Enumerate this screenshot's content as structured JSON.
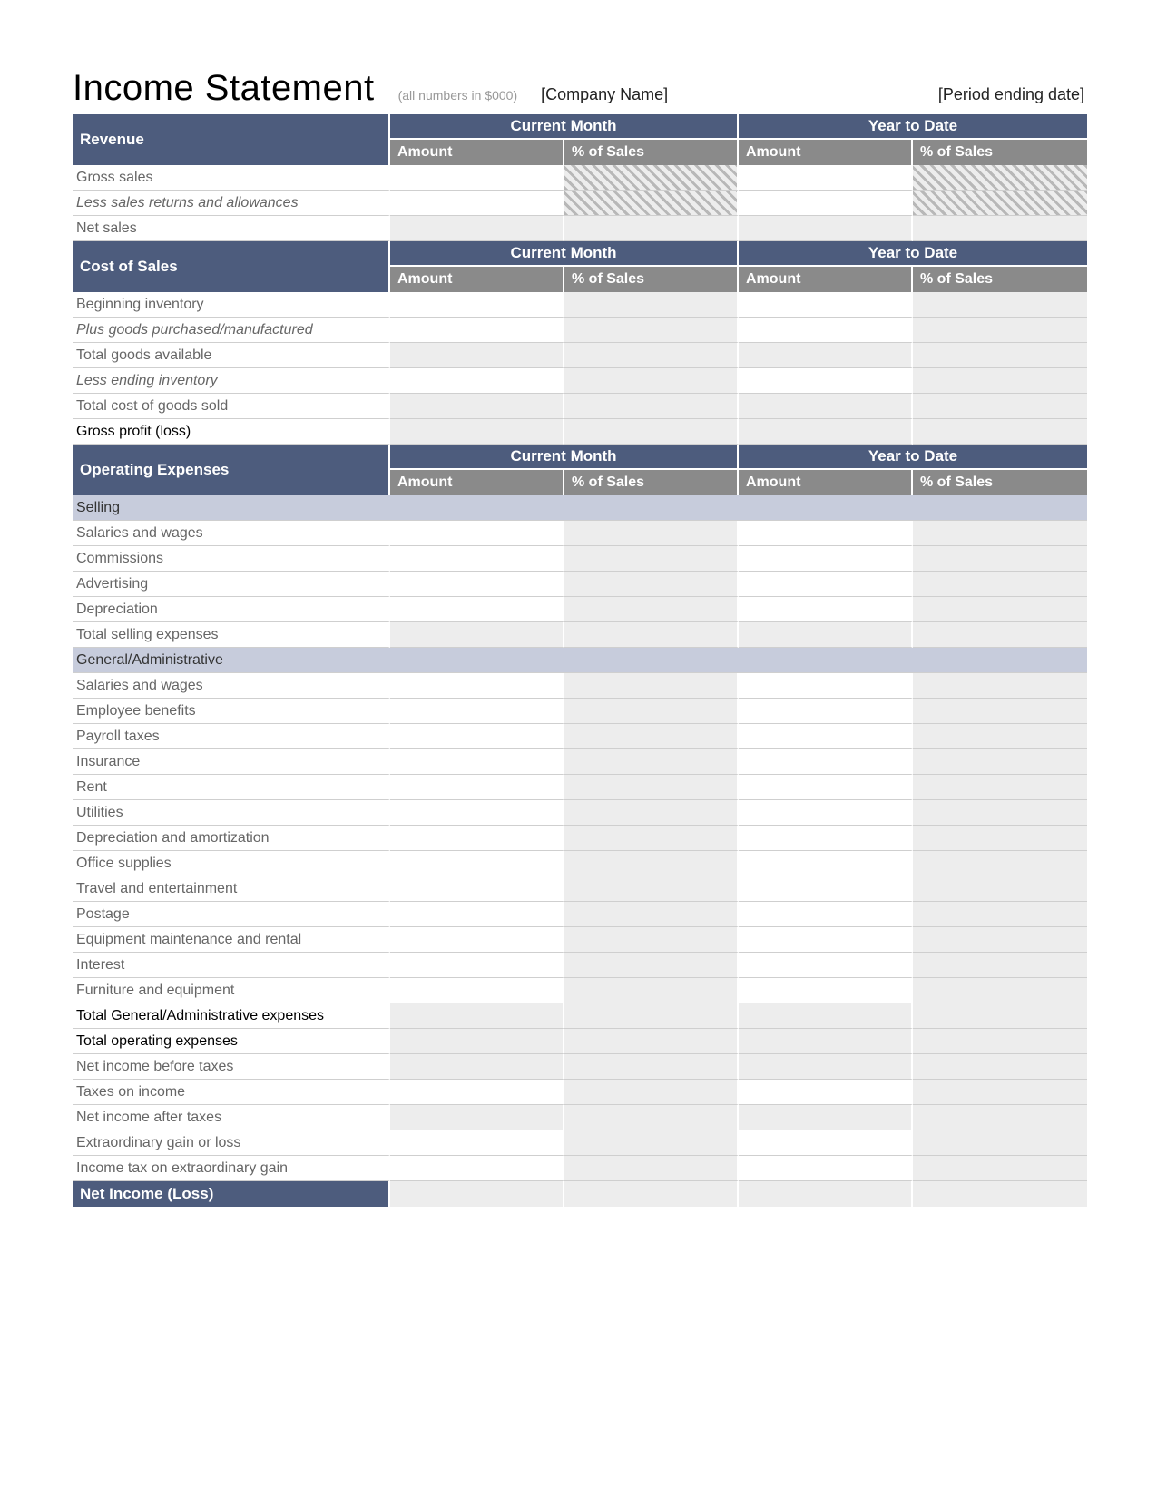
{
  "header": {
    "title": "Income Statement",
    "subtitle": "(all numbers in $000)",
    "company": "[Company Name]",
    "period": "[Period ending date]"
  },
  "columns": {
    "period1": "Current Month",
    "period2": "Year to Date",
    "amount": "Amount",
    "pct": "% of Sales"
  },
  "sections": {
    "revenue": {
      "title": "Revenue",
      "rows": [
        "Gross sales",
        "Less sales returns and allowances",
        "Net sales"
      ]
    },
    "cost": {
      "title": "Cost of Sales",
      "rows": [
        "Beginning inventory",
        "Plus goods purchased/manufactured",
        "Total goods available",
        "Less ending inventory",
        "Total cost of goods sold",
        "Gross profit (loss)"
      ]
    },
    "opex": {
      "title": "Operating Expenses",
      "selling": {
        "band": "Selling",
        "rows": [
          "Salaries and wages",
          "Commissions",
          "Advertising",
          "Depreciation",
          "Total selling expenses"
        ]
      },
      "ga": {
        "band": "General/Administrative",
        "rows": [
          "Salaries and wages",
          "Employee benefits",
          "Payroll taxes",
          "Insurance",
          "Rent",
          "Utilities",
          "Depreciation and amortization",
          "Office supplies",
          "Travel and entertainment",
          "Postage",
          "Equipment maintenance and rental",
          "Interest",
          "Furniture and equipment",
          "Total General/Administrative expenses",
          "Total operating expenses",
          "Net income before taxes",
          "Taxes on income",
          "Net income after taxes",
          "Extraordinary gain or loss",
          "Income tax on extraordinary gain"
        ]
      }
    },
    "footer": "Net Income (Loss)"
  }
}
